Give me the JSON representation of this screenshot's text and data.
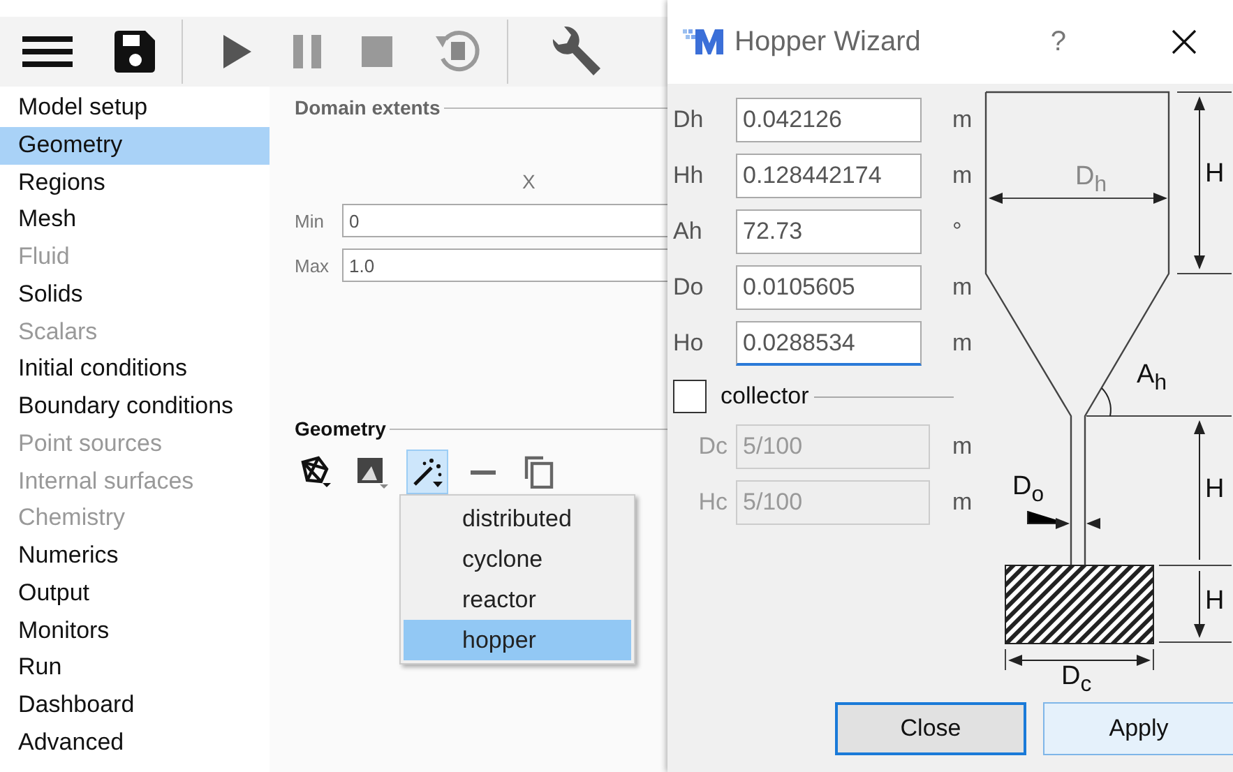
{
  "sidebar": {
    "items": [
      {
        "label": "Model setup",
        "selected": false,
        "disabled": false
      },
      {
        "label": "Geometry",
        "selected": true,
        "disabled": false
      },
      {
        "label": "Regions",
        "selected": false,
        "disabled": false
      },
      {
        "label": "Mesh",
        "selected": false,
        "disabled": false
      },
      {
        "label": "Fluid",
        "selected": false,
        "disabled": true
      },
      {
        "label": "Solids",
        "selected": false,
        "disabled": false
      },
      {
        "label": "Scalars",
        "selected": false,
        "disabled": true
      },
      {
        "label": "Initial conditions",
        "selected": false,
        "disabled": false
      },
      {
        "label": "Boundary conditions",
        "selected": false,
        "disabled": false
      },
      {
        "label": "Point sources",
        "selected": false,
        "disabled": true
      },
      {
        "label": "Internal surfaces",
        "selected": false,
        "disabled": true
      },
      {
        "label": "Chemistry",
        "selected": false,
        "disabled": true
      },
      {
        "label": "Numerics",
        "selected": false,
        "disabled": false
      },
      {
        "label": "Output",
        "selected": false,
        "disabled": false
      },
      {
        "label": "Monitors",
        "selected": false,
        "disabled": false
      },
      {
        "label": "Run",
        "selected": false,
        "disabled": false
      },
      {
        "label": "Dashboard",
        "selected": false,
        "disabled": false
      },
      {
        "label": "Advanced",
        "selected": false,
        "disabled": false
      }
    ]
  },
  "domain_extents": {
    "title": "Domain extents",
    "column_header": "X",
    "rows": [
      {
        "label": "Min",
        "value": "0"
      },
      {
        "label": "Max",
        "value": "1.0"
      }
    ]
  },
  "geometry": {
    "title": "Geometry",
    "tools": [
      {
        "kind": "polygon",
        "active": false
      },
      {
        "kind": "image",
        "active": false
      },
      {
        "kind": "wizard",
        "active": true
      },
      {
        "kind": "remove",
        "active": false
      },
      {
        "kind": "copy",
        "active": false
      }
    ],
    "menu": {
      "items": [
        {
          "label": "distributed",
          "selected": false
        },
        {
          "label": "cyclone",
          "selected": false
        },
        {
          "label": "reactor",
          "selected": false
        },
        {
          "label": "hopper",
          "selected": true
        }
      ]
    }
  },
  "dialog": {
    "title": "Hopper Wizard",
    "help": "?",
    "fields": [
      {
        "label": "Dh",
        "value": "0.042126",
        "unit": "m",
        "focused": false
      },
      {
        "label": "Hh",
        "value": "0.128442174",
        "unit": "m",
        "focused": false
      },
      {
        "label": "Ah",
        "value": "72.73",
        "unit": "°",
        "focused": false
      },
      {
        "label": "Do",
        "value": "0.0105605",
        "unit": "m",
        "focused": false
      },
      {
        "label": "Ho",
        "value": "0.0288534",
        "unit": "m",
        "focused": true
      }
    ],
    "collector": {
      "label": "collector",
      "checked": false,
      "fields": [
        {
          "label": "Dc",
          "value": "5/100",
          "unit": "m",
          "disabled": true
        },
        {
          "label": "Hc",
          "value": "5/100",
          "unit": "m",
          "disabled": true
        }
      ]
    },
    "diagram_labels": [
      "D$_{h}$",
      "H",
      "A$_{h}$",
      "D$_{o}$",
      "H",
      "H",
      "D$_{c}$"
    ],
    "buttons": [
      {
        "label": "Close",
        "default": true
      },
      {
        "label": "Apply",
        "default": false
      }
    ]
  }
}
